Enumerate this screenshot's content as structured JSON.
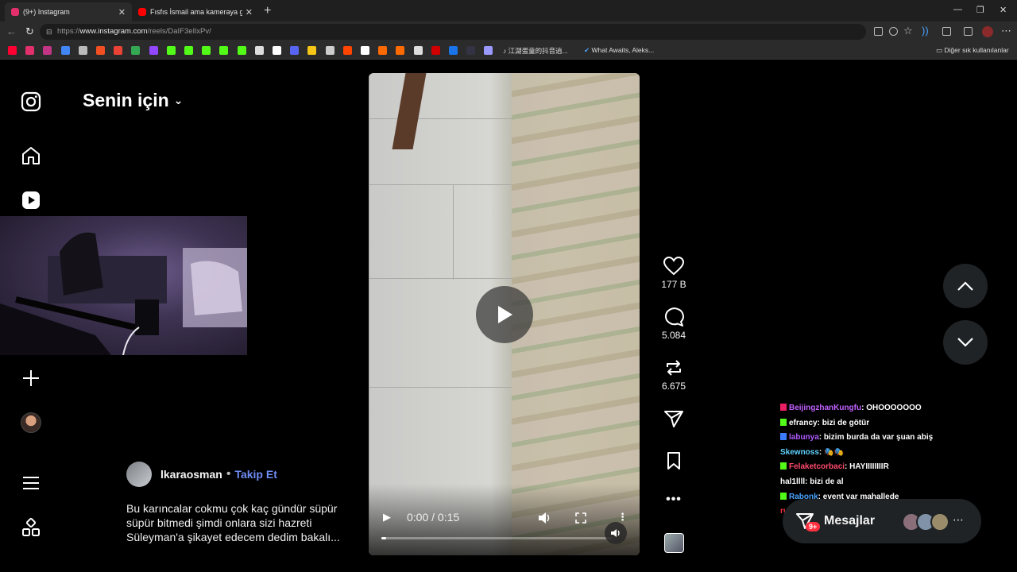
{
  "browser": {
    "tabs": [
      {
        "title": "(9+) Instagram",
        "active": true,
        "favicon_color": "#e1306c"
      },
      {
        "title": "Fısfıs İsmail ama kameraya gereks",
        "active": false,
        "favicon_color": "#ff0000"
      }
    ],
    "url_prefix": "https://",
    "url_host": "www.instagram.com",
    "url_path": "/reels/DaIF3eIlxPv/",
    "bookmarks": [
      {
        "icon": "youtube-bookmark",
        "color": "#ff0033"
      },
      {
        "icon": "instagram-bookmark",
        "color": "#e1306c"
      },
      {
        "icon": "instagram-bookmark-2",
        "color": "#c13584"
      },
      {
        "icon": "translate-bookmark",
        "color": "#4285f4"
      },
      {
        "icon": "globe-bookmark",
        "color": "#bbbbbb"
      },
      {
        "icon": "microsoft-bookmark",
        "color": "#f25022"
      },
      {
        "icon": "gmail-bookmark",
        "color": "#ea4335"
      },
      {
        "icon": "drive-bookmark",
        "color": "#34a853"
      },
      {
        "icon": "twitch-bookmark",
        "color": "#9146ff"
      },
      {
        "icon": "kick-bookmark",
        "color": "#53fc18"
      },
      {
        "icon": "kick-bookmark-2",
        "color": "#53fc18"
      },
      {
        "icon": "kick-bookmark-3",
        "color": "#53fc18"
      },
      {
        "icon": "xbox-bookmark",
        "color": "#53fc18"
      },
      {
        "icon": "xbox-bookmark-2",
        "color": "#53fc18"
      },
      {
        "icon": "anchor-bookmark",
        "color": "#dddddd"
      },
      {
        "icon": "x-bookmark",
        "color": "#ffffff"
      },
      {
        "icon": "app-bookmark",
        "color": "#5865f2"
      },
      {
        "icon": "app-bookmark-2",
        "color": "#f5c518"
      },
      {
        "icon": "app-bookmark-3",
        "color": "#cccccc"
      },
      {
        "icon": "reddit-bookmark",
        "color": "#ff4500"
      },
      {
        "icon": "p-bookmark",
        "color": "#ffffff"
      },
      {
        "icon": "app-bookmark-4",
        "color": "#ff6a00"
      },
      {
        "icon": "app-bookmark-5",
        "color": "#ff6a00"
      },
      {
        "icon": "app-bookmark-6",
        "color": "#dddddd"
      },
      {
        "icon": "app-bookmark-7",
        "color": "#d10000"
      },
      {
        "icon": "app-bookmark-8",
        "color": "#1a73e8"
      },
      {
        "icon": "hwl-bookmark",
        "color": "#334"
      },
      {
        "icon": "app-bookmark-9",
        "color": "#9999ff"
      }
    ],
    "bookmark_text_1": "江湖蛋童的抖音逍...",
    "bookmark_text_2": "What Awaits, Aleks...",
    "other_bookmarks": "Diğer sık kullanılanlar"
  },
  "header": {
    "title": "Senin için"
  },
  "video": {
    "current_time": "0:00",
    "duration": "0:15",
    "time_display": "0:00 / 0:15",
    "progress_fraction": 0.0
  },
  "actions": {
    "likes": "177 B",
    "comments": "5.084",
    "reposts": "6.675"
  },
  "post": {
    "author": "lkaraosman",
    "separator": "•",
    "follow_label": "Takip Et",
    "caption": "Bu karıncalar cokmu çok kaç gündür süpür süpür bitmedi şimdi onlara sizi hazreti Süleyman'a şikayet edecem dedim bakalı..."
  },
  "chat": [
    {
      "user": "BeijingzhanKungfu",
      "msg": "OHOOOOOOO",
      "color": "#c061ff",
      "badge": "#e91e63"
    },
    {
      "user": "efrancy",
      "msg": "bizi de götür",
      "color": "#ffffff",
      "badge": "#53fc18"
    },
    {
      "user": "labunya",
      "msg": "bizim burda da var şuan abiş",
      "color": "#b05cff",
      "badge": "#3a7bff"
    },
    {
      "user": "Skewnoss",
      "msg": "🎭🎭",
      "color": "#5fd3ff",
      "badge": ""
    },
    {
      "user": "Felaketcorbaci",
      "msg": "HAYIIIIIIIIR",
      "color": "#ff4b6e",
      "badge": "#53fc18"
    },
    {
      "user": "hal1llll",
      "msg": "bizi de al",
      "color": "#ffffff",
      "badge": ""
    },
    {
      "user": "Rabonk",
      "msg": "event var mahallede",
      "color": "#4aa3ff",
      "badge": "#53fc18"
    },
    {
      "user": "ruhlarere",
      "msg": "ohooo",
      "color": "#ff3040",
      "badge": ""
    }
  ],
  "messages": {
    "label": "Mesajlar",
    "badge": "9+"
  }
}
